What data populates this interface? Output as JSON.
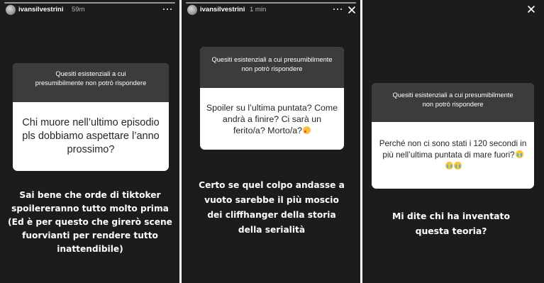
{
  "stories": [
    {
      "username": "ivansilvestrini",
      "time": "59m",
      "question_title": "Quesiti esistenziali a cui presumibilmente non potrò rispondere",
      "question": "Chi muore nell’ultimo episodio pls dobbiamo aspettare l’anno prossimo?",
      "answer": "Sai bene che orde di tiktoker spoilereranno tutto molto prima (Ed è per questo che girerò scene fuorvianti per rendere tutto inattendibile)"
    },
    {
      "username": "ivansilvestrini",
      "time": "1 min",
      "question_title": "Quesiti esistenziali a cui presumibilmente non potrò rispondere",
      "question": "Spoiler su l’ultima puntata? Come andrà a finire? Ci sarà un ferito/a? Morto/a?",
      "question_emoji": "smiling-face-with-hearts",
      "answer": "Certo se quel colpo andasse a vuoto sarebbe il più moscio dei cliffhanger della storia della serialità"
    },
    {
      "question_title": "Quesiti esistenziali a cui presumibilmente non potrò rispondere",
      "question": "Perché non ci sono stati i 120 secondi in più nell’ultima puntata di mare fuori?",
      "question_emoji": "crying-face",
      "answer": "Mi dite chi ha inventato questa teoria?"
    }
  ],
  "colors": {
    "panel_bg": "#1c1c1c",
    "card_title_bg": "#3c3c3c",
    "card_body_bg": "#ffffff",
    "text_light": "#ffffff",
    "text_dark": "#262626"
  },
  "icons": {
    "more": "more-horizontal-icon",
    "close": "close-icon"
  }
}
